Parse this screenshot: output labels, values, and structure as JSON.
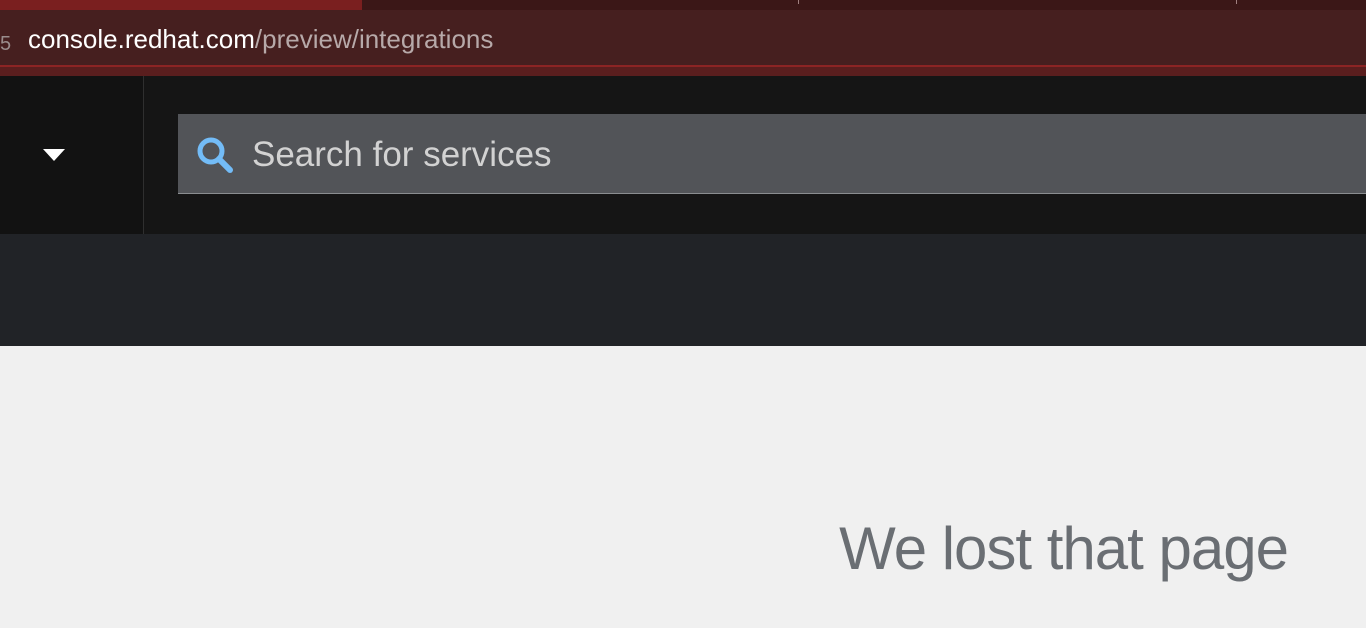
{
  "browser": {
    "url_host": "console.redhat.com",
    "url_path": "/preview/integrations",
    "left_fragment": "5"
  },
  "masthead": {
    "dropdown_icon": "caret-down-icon",
    "search_icon": "search-icon",
    "search_placeholder": "Search for services"
  },
  "main": {
    "error_title": "We lost that page"
  },
  "colors": {
    "browser_chrome": "#5a1e1e",
    "masthead_bg": "#151515",
    "search_bg": "#525458",
    "search_icon": "#73bcf7",
    "subheader_bg": "#212327",
    "page_bg": "#f0f0f0",
    "title_text": "#6a6e73"
  }
}
